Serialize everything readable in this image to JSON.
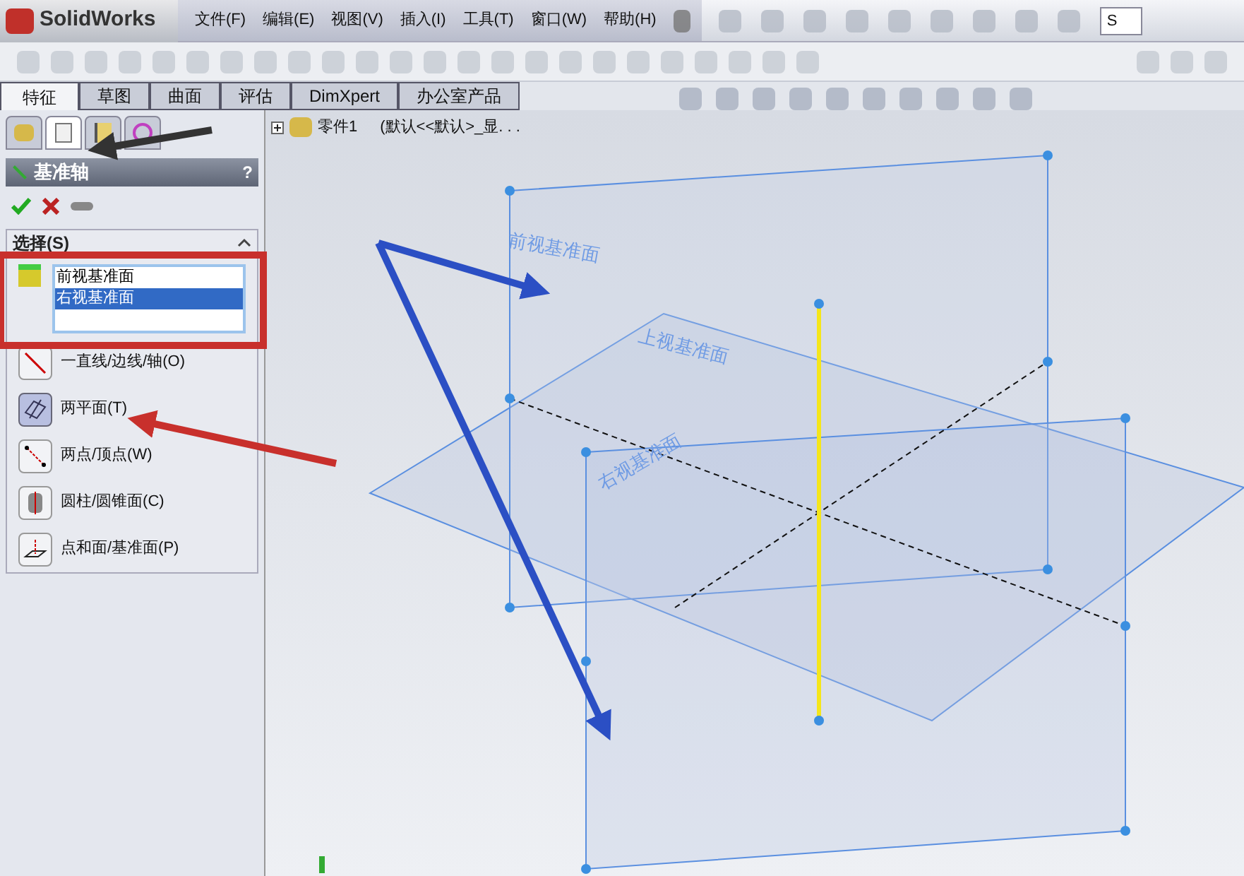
{
  "app": {
    "title": "SolidWorks"
  },
  "menu": [
    "文件(F)",
    "编辑(E)",
    "视图(V)",
    "插入(I)",
    "工具(T)",
    "窗口(W)",
    "帮助(H)"
  ],
  "search": {
    "value": "S"
  },
  "tabs": [
    {
      "label": "特征",
      "selected": true
    },
    {
      "label": "草图",
      "selected": false
    },
    {
      "label": "曲面",
      "selected": false
    },
    {
      "label": "评估",
      "selected": false
    },
    {
      "label": "DimXpert",
      "selected": false
    },
    {
      "label": "办公室产品",
      "selected": false
    }
  ],
  "panel_tabs": [
    {
      "kind": "feature",
      "selected": false
    },
    {
      "kind": "property",
      "selected": true
    },
    {
      "kind": "config",
      "selected": false
    },
    {
      "kind": "dimxpert",
      "selected": false
    }
  ],
  "property_manager": {
    "title": "基准轴",
    "help": "?",
    "section": {
      "title": "选择(S)",
      "expanded": true,
      "selections": [
        {
          "label": "前视基准面",
          "selected": false
        },
        {
          "label": "右视基准面",
          "selected": true
        }
      ]
    },
    "options": [
      {
        "kind": "line",
        "label": "一直线/边线/轴(O)",
        "selected": false
      },
      {
        "kind": "planes",
        "label": "两平面(T)",
        "selected": true
      },
      {
        "kind": "points",
        "label": "两点/顶点(W)",
        "selected": false
      },
      {
        "kind": "cylinder",
        "label": "圆柱/圆锥面(C)",
        "selected": false
      },
      {
        "kind": "pointplane",
        "label": "点和面/基准面(P)",
        "selected": false
      }
    ]
  },
  "tree": {
    "label": "零件1",
    "config": "(默认<<默认>_显. . ."
  },
  "planes": [
    {
      "label": "前视基准面"
    },
    {
      "label": "上视基准面"
    },
    {
      "label": "右视基准面"
    }
  ]
}
